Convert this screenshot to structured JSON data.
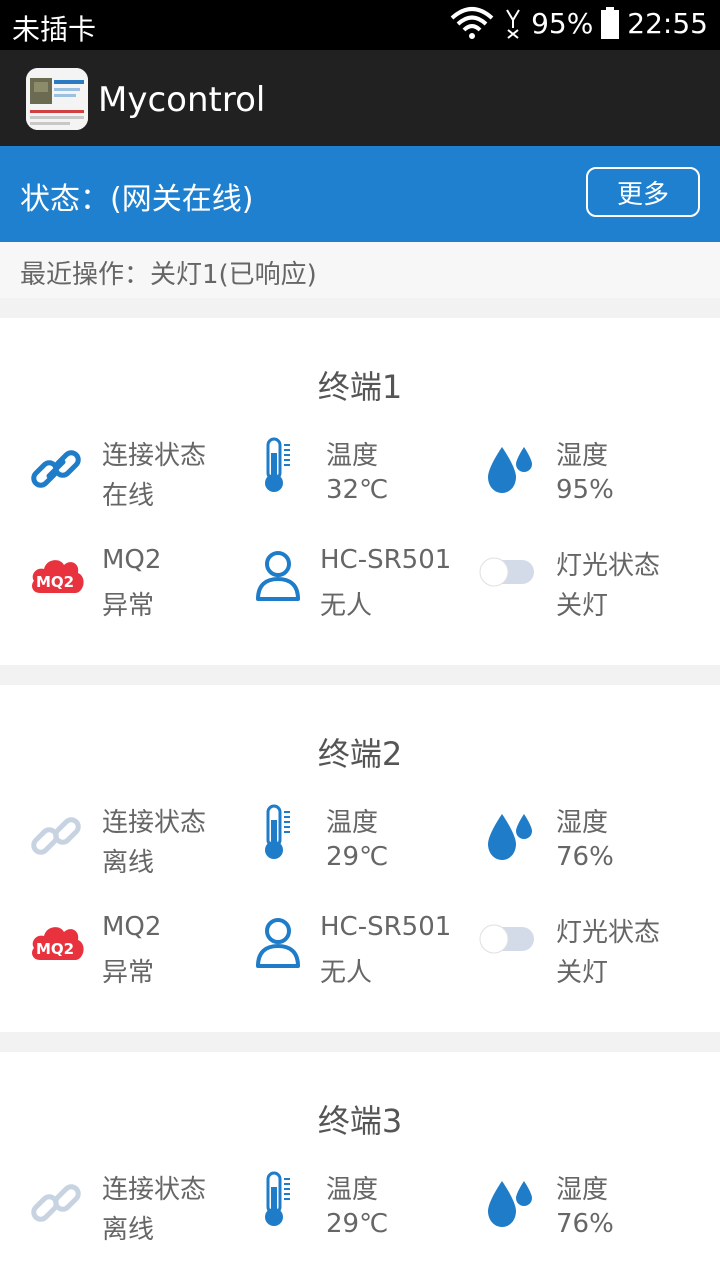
{
  "status_bar": {
    "carrier": "未插卡",
    "battery": "95%",
    "time": "22:55"
  },
  "app_bar": {
    "title": "Mycontrol"
  },
  "gateway": {
    "state": "状态：(网关在线)",
    "more_label": "更多"
  },
  "recent": "最近操作：关灯1(已响应)",
  "terminals": [
    {
      "title": "终端1",
      "connection": {
        "label": "连接状态",
        "value": "在线"
      },
      "temperature": {
        "label": "温度",
        "value": "32℃"
      },
      "humidity": {
        "label": "湿度",
        "value": "95%"
      },
      "mq2": {
        "label": "MQ2",
        "value": "异常",
        "badge": "MQ2"
      },
      "pir": {
        "label": "HC-SR501",
        "value": "无人"
      },
      "light": {
        "label": "灯光状态",
        "value": "关灯"
      }
    },
    {
      "title": "终端2",
      "connection": {
        "label": "连接状态",
        "value": "离线"
      },
      "temperature": {
        "label": "温度",
        "value": "29℃"
      },
      "humidity": {
        "label": "湿度",
        "value": "76%"
      },
      "mq2": {
        "label": "MQ2",
        "value": "异常",
        "badge": "MQ2"
      },
      "pir": {
        "label": "HC-SR501",
        "value": "无人"
      },
      "light": {
        "label": "灯光状态",
        "value": "关灯"
      }
    },
    {
      "title": "终端3",
      "connection": {
        "label": "连接状态",
        "value": "离线"
      },
      "temperature": {
        "label": "温度",
        "value": "29℃"
      },
      "humidity": {
        "label": "湿度",
        "value": "76%"
      }
    }
  ],
  "colors": {
    "accent": "#1e80cf",
    "icon_blue": "#1e7cc8",
    "offline_gray": "#c8d3e2",
    "alert_red": "#e8333f"
  }
}
